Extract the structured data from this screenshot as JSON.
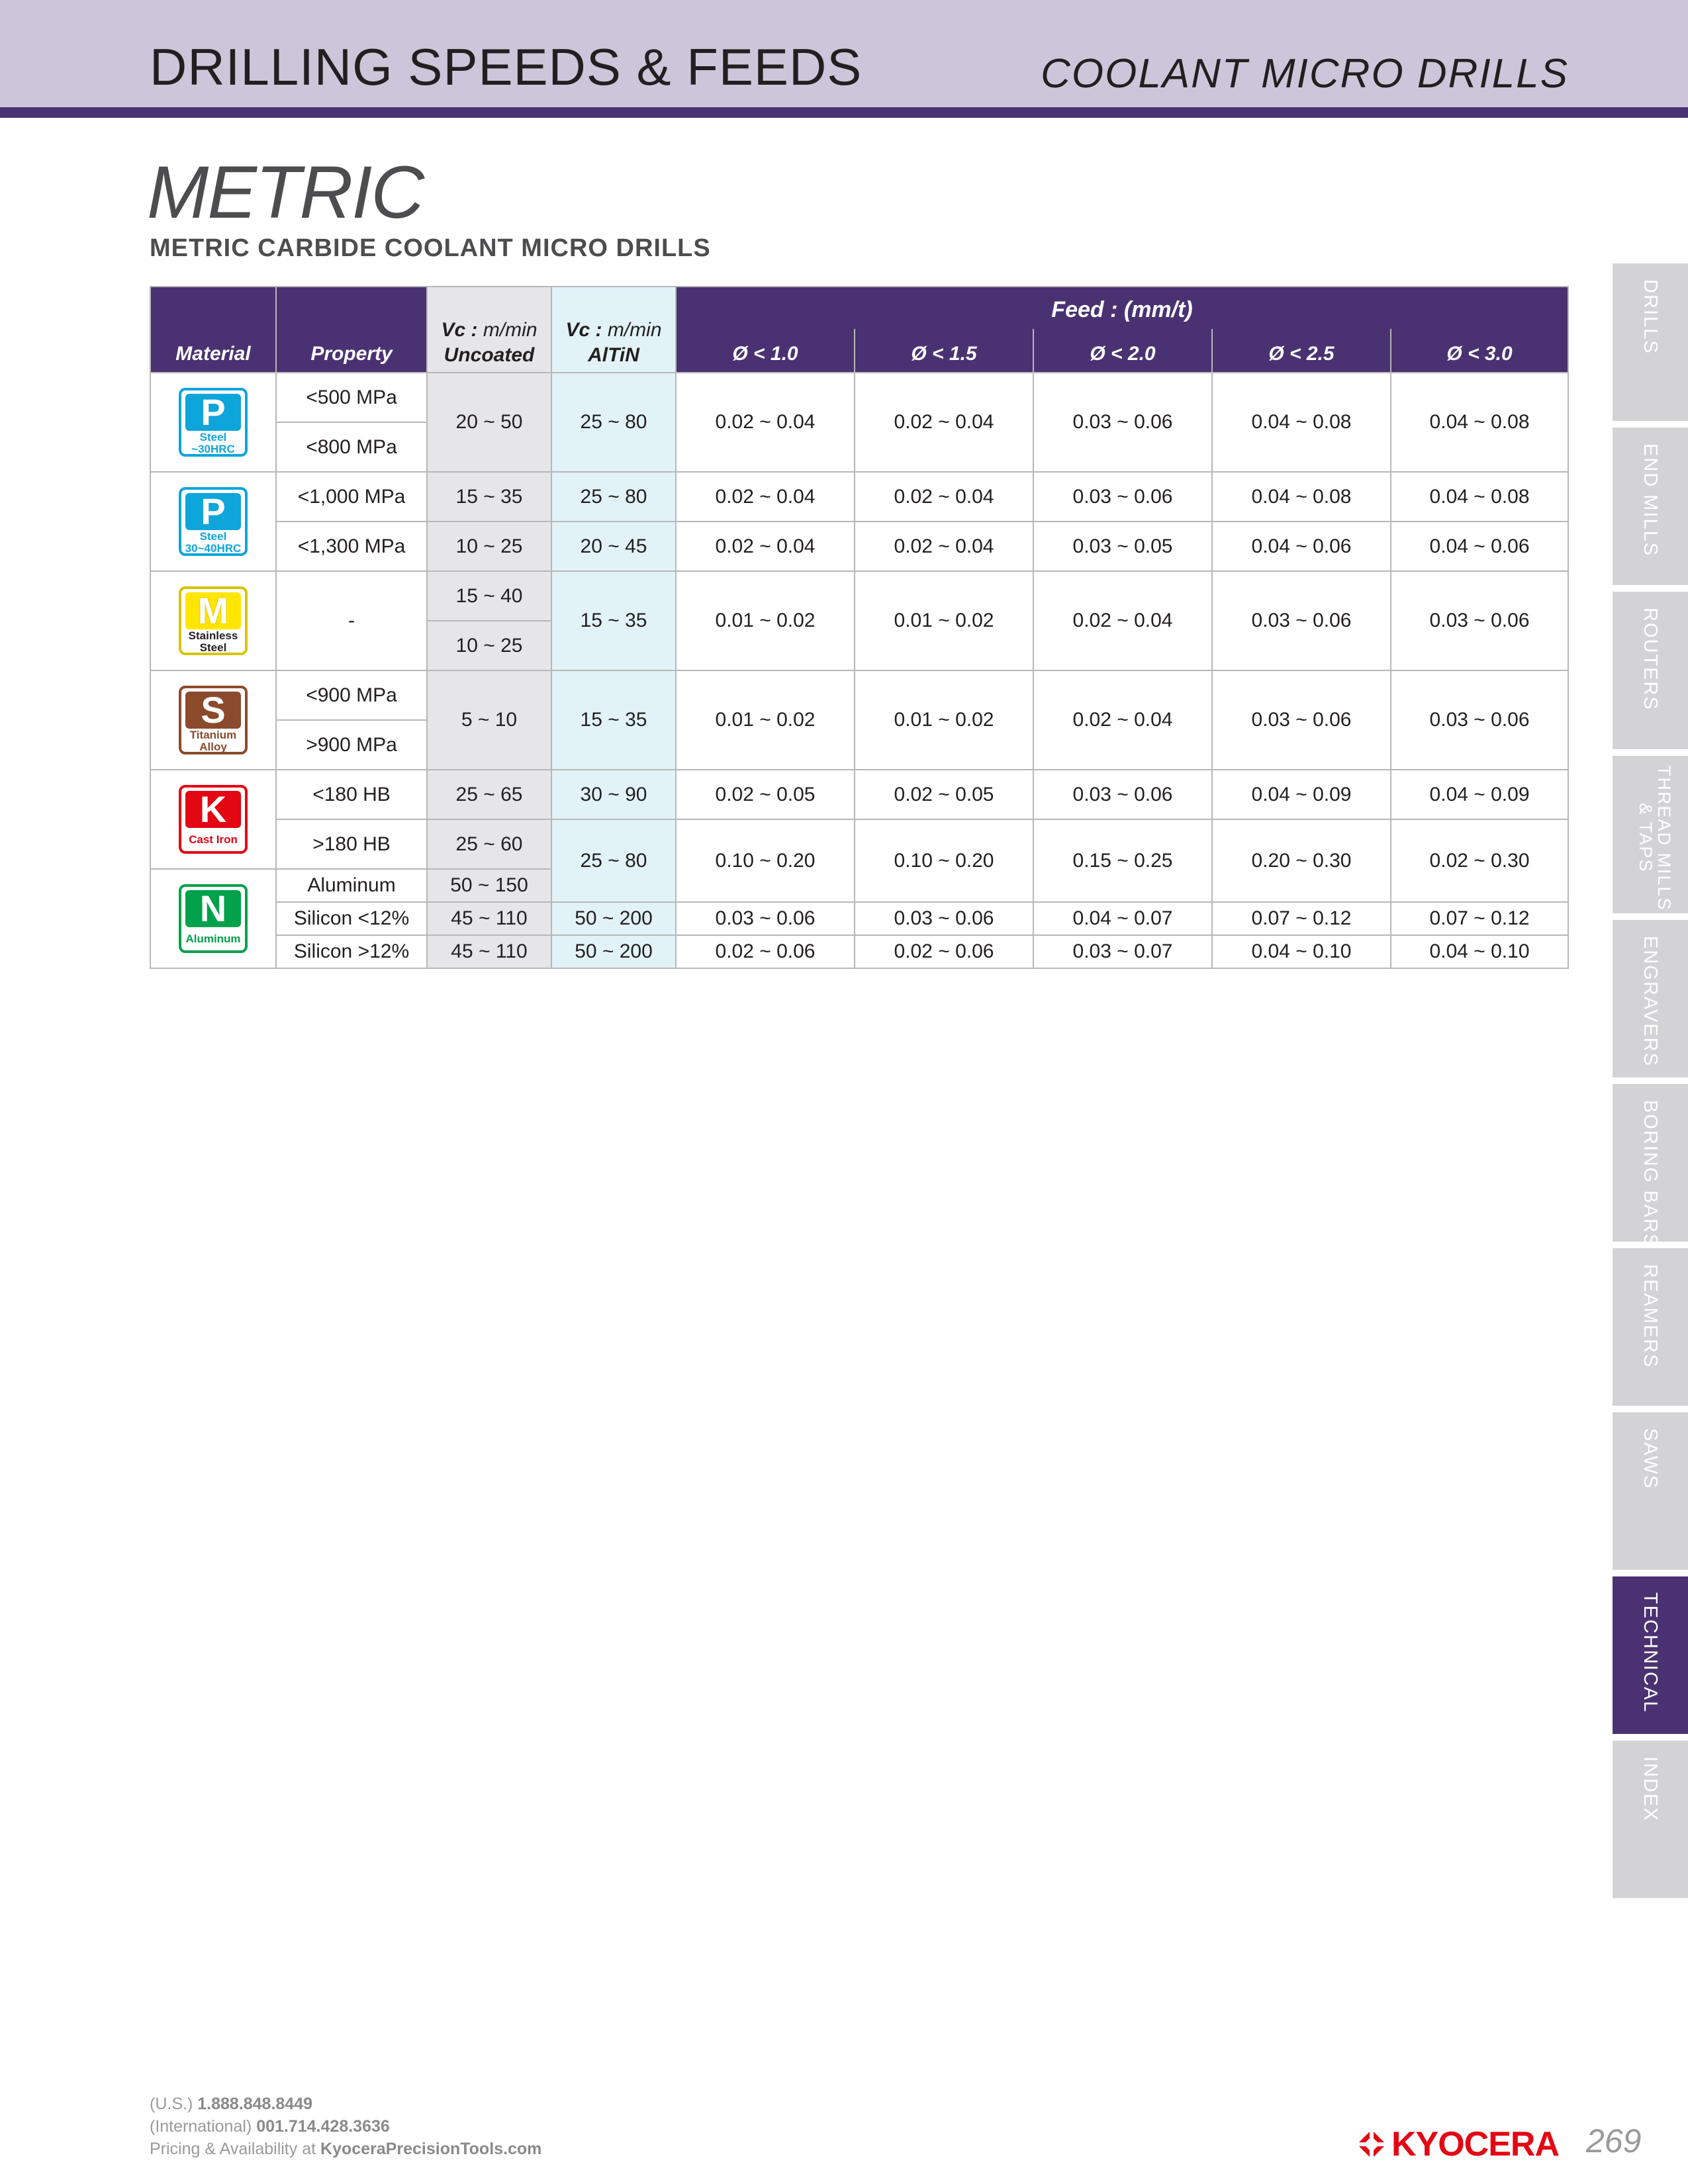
{
  "header": {
    "title": "DRILLING SPEEDS & FEEDS",
    "subtitle": "COOLANT MICRO DRILLS"
  },
  "section": {
    "title": "METRIC",
    "subtitle": "METRIC CARBIDE COOLANT MICRO DRILLS"
  },
  "table": {
    "headers": {
      "material": "Material",
      "property": "Property",
      "vc_label": "Vc :",
      "vc_unit": "m/min",
      "uncoated": "Uncoated",
      "altin": "AlTiN",
      "feed": "Feed : (mm/t)",
      "diameters": [
        "Ø < 1.0",
        "Ø < 1.5",
        "Ø < 2.0",
        "Ø < 2.5",
        "Ø < 3.0"
      ]
    },
    "materials": [
      {
        "letter": "P",
        "caption": "Steel\n~30HRC",
        "color": "#0ea5da"
      },
      {
        "letter": "P",
        "caption": "Steel\n30~40HRC",
        "color": "#0ea5da"
      },
      {
        "letter": "M",
        "caption": "Stainless\nSteel",
        "color": "#ffe600"
      },
      {
        "letter": "S",
        "caption": "Titanium\nAlloy",
        "color": "#8b4a2b"
      },
      {
        "letter": "K",
        "caption": "Cast Iron",
        "color": "#e30613"
      },
      {
        "letter": "N",
        "caption": "Aluminum",
        "color": "#00a14b"
      }
    ],
    "rows": {
      "p1": {
        "prop_a": "<500 MPa",
        "prop_b": "<800 MPa",
        "unc": "20 ~ 50",
        "alt": "25 ~ 80",
        "feeds": [
          "0.02 ~ 0.04",
          "0.02 ~ 0.04",
          "0.03 ~ 0.06",
          "0.04 ~ 0.08",
          "0.04 ~ 0.08"
        ]
      },
      "p2a": {
        "prop": "<1,000 MPa",
        "unc": "15 ~ 35",
        "alt": "25 ~ 80",
        "feeds": [
          "0.02 ~ 0.04",
          "0.02 ~ 0.04",
          "0.03 ~ 0.06",
          "0.04 ~ 0.08",
          "0.04 ~ 0.08"
        ]
      },
      "p2b": {
        "prop": "<1,300 MPa",
        "unc": "10 ~ 25",
        "alt": "20 ~ 45",
        "feeds": [
          "0.02 ~ 0.04",
          "0.02 ~ 0.04",
          "0.03 ~ 0.05",
          "0.04 ~ 0.06",
          "0.04 ~ 0.06"
        ]
      },
      "m": {
        "prop": "-",
        "unc_a": "15 ~ 40",
        "unc_b": "10 ~ 25",
        "alt": "15 ~ 35",
        "feeds": [
          "0.01 ~ 0.02",
          "0.01 ~ 0.02",
          "0.02 ~ 0.04",
          "0.03 ~ 0.06",
          "0.03 ~ 0.06"
        ]
      },
      "s": {
        "prop_a": "<900 MPa",
        "prop_b": ">900 MPa",
        "unc": "5 ~ 10",
        "alt": "15 ~ 35",
        "feeds": [
          "0.01 ~ 0.02",
          "0.01 ~ 0.02",
          "0.02 ~ 0.04",
          "0.03 ~ 0.06",
          "0.03 ~ 0.06"
        ]
      },
      "k1": {
        "prop": "<180 HB",
        "unc": "25 ~ 65",
        "alt": "30 ~ 90",
        "feeds": [
          "0.02 ~ 0.05",
          "0.02 ~ 0.05",
          "0.03 ~ 0.06",
          "0.04 ~ 0.09",
          "0.04 ~ 0.09"
        ]
      },
      "k2": {
        "prop": ">180 HB",
        "unc": "25 ~ 60",
        "alt": "25 ~ 80",
        "feeds": [
          "0.10 ~ 0.20",
          "0.10 ~ 0.20",
          "0.15 ~ 0.25",
          "0.20 ~ 0.30",
          "0.02 ~ 0.30"
        ]
      },
      "n1": {
        "prop": "Aluminum",
        "unc": "50 ~ 150"
      },
      "n2": {
        "prop": "Silicon <12%",
        "unc": "45 ~ 110",
        "alt": "50 ~ 200",
        "feeds": [
          "0.03 ~ 0.06",
          "0.03 ~ 0.06",
          "0.04 ~ 0.07",
          "0.07 ~ 0.12",
          "0.07 ~ 0.12"
        ]
      },
      "n3": {
        "prop": "Silicon >12%",
        "unc": "45 ~ 110",
        "alt": "50 ~ 200",
        "feeds": [
          "0.02 ~ 0.06",
          "0.02 ~ 0.06",
          "0.03 ~ 0.07",
          "0.04 ~ 0.10",
          "0.04 ~ 0.10"
        ]
      }
    }
  },
  "side_tabs": [
    {
      "label": "DRILLS"
    },
    {
      "label": "END MILLS"
    },
    {
      "label": "ROUTERS"
    },
    {
      "label": "THREAD MILLS & TAPS"
    },
    {
      "label": "ENGRAVERS"
    },
    {
      "label": "BORING BARS"
    },
    {
      "label": "REAMERS"
    },
    {
      "label": "SAWS"
    },
    {
      "label": "TECHNICAL",
      "active": true
    },
    {
      "label": "INDEX"
    }
  ],
  "footer": {
    "us_label": "(U.S.)",
    "us_phone": "1.888.848.8449",
    "intl_label": "(International)",
    "intl_phone": "001.714.428.3636",
    "pricing_label": "Pricing & Availability at",
    "website": "KyoceraPrecisionTools.com"
  },
  "brand": {
    "name": "KYOCERA",
    "color": "#e30613"
  },
  "page_number": "269",
  "colors": {
    "accent": "#4a3272",
    "header_bg": "#cdc5d9",
    "uncoated_bg": "#e6e6e8",
    "altin_bg": "#e2f3f8"
  }
}
